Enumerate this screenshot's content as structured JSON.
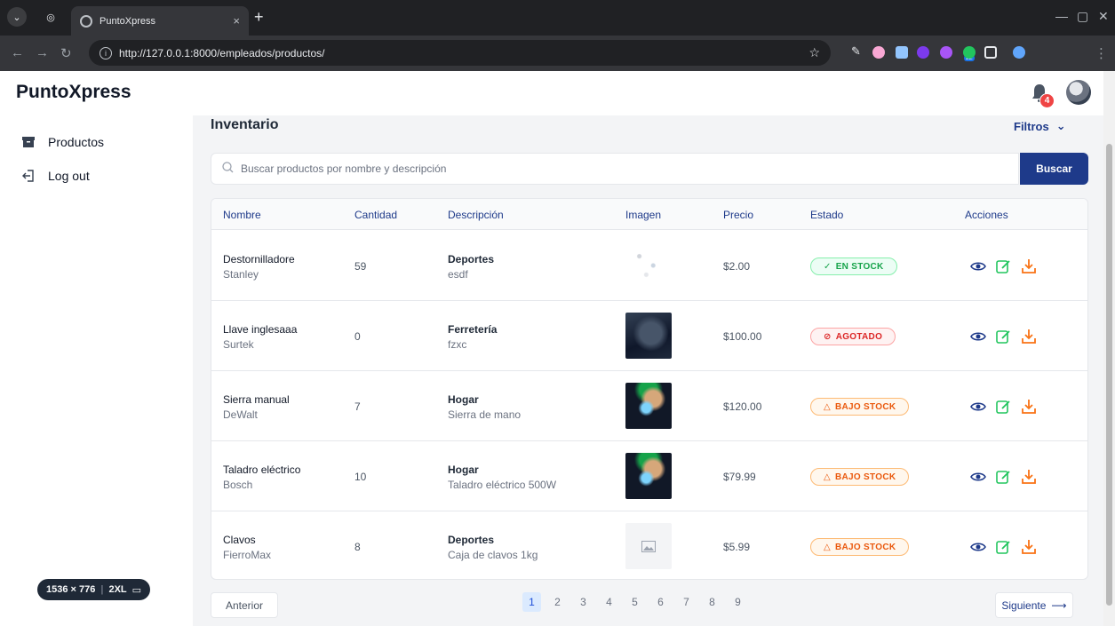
{
  "browser": {
    "tab_title": "PuntoXpress",
    "tab_close": "×",
    "new_tab": "+",
    "url": "http://127.0.0.1:8000/empleados/productos/",
    "extension_badge": "22"
  },
  "app": {
    "brand": "PuntoXpress",
    "notification_count": "4"
  },
  "sidebar": {
    "items": [
      {
        "label": "Productos",
        "icon": "box-icon"
      },
      {
        "label": "Log out",
        "icon": "logout-icon"
      }
    ]
  },
  "devtools": {
    "viewport": "1536 × 776",
    "breakpoint": "2XL"
  },
  "main": {
    "title": "Inventario",
    "filters_label": "Filtros",
    "search_placeholder": "Buscar productos por nombre y descripción",
    "search_button": "Buscar"
  },
  "table": {
    "headers": [
      "Nombre",
      "Cantidad",
      "Descripción",
      "Imagen",
      "Precio",
      "Estado",
      "Acciones"
    ],
    "rows": [
      {
        "name": "Destornilladore",
        "brand": "Stanley",
        "qty": "59",
        "category": "Deportes",
        "desc": "esdf",
        "image": "noise",
        "price": "$2.00",
        "status": "EN STOCK",
        "status_type": "ok"
      },
      {
        "name": "Llave inglesaaa",
        "brand": "Surtek",
        "qty": "0",
        "category": "Ferretería",
        "desc": "fzxc",
        "image": "photo-dark",
        "price": "$100.00",
        "status": "AGOTADO",
        "status_type": "out"
      },
      {
        "name": "Sierra manual",
        "brand": "DeWalt",
        "qty": "7",
        "category": "Hogar",
        "desc": "Sierra de mano",
        "image": "photo-art",
        "price": "$120.00",
        "status": "BAJO STOCK",
        "status_type": "low"
      },
      {
        "name": "Taladro eléctrico",
        "brand": "Bosch",
        "qty": "10",
        "category": "Hogar",
        "desc": "Taladro eléctrico 500W",
        "image": "photo-art",
        "price": "$79.99",
        "status": "BAJO STOCK",
        "status_type": "low"
      },
      {
        "name": "Clavos",
        "brand": "FierroMax",
        "qty": "8",
        "category": "Deportes",
        "desc": "Caja de clavos 1kg",
        "image": "placeholder",
        "price": "$5.99",
        "status": "BAJO STOCK",
        "status_type": "low"
      }
    ]
  },
  "pagination": {
    "prev": "Anterior",
    "next": "Siguiente",
    "pages": [
      "1",
      "2",
      "3",
      "4",
      "5",
      "6",
      "7",
      "8",
      "9"
    ],
    "current": "1"
  },
  "colors": {
    "primary": "#1e3a8a",
    "ok": "#16a34a",
    "out": "#dc2626",
    "low": "#ea580c"
  }
}
